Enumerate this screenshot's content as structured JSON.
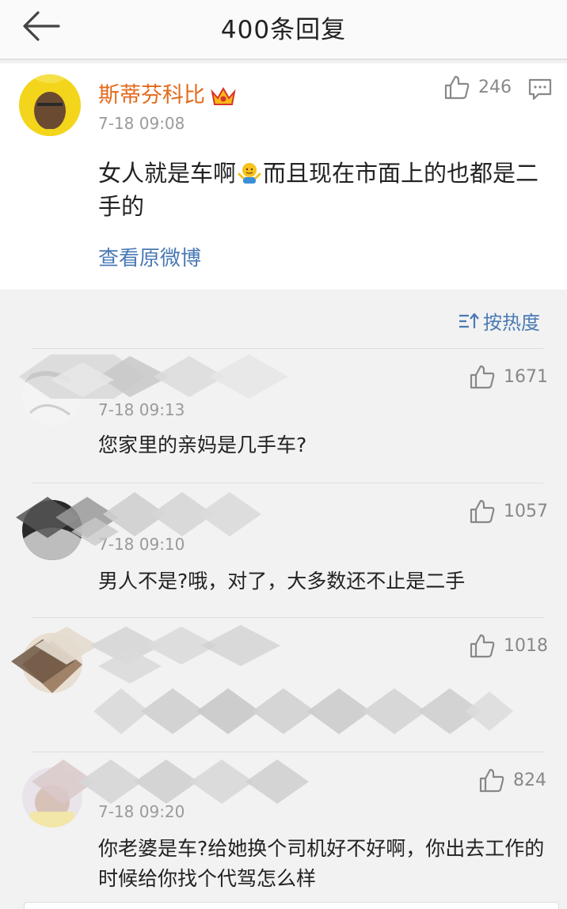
{
  "header": {
    "title": "400条回复"
  },
  "origin": {
    "name": "斯蒂芬科比",
    "time": "7-18 09:08",
    "likes": "246",
    "text_part1": "女人就是车啊",
    "text_part2": "而且现在市面上的也都是二手的",
    "view_original": "查看原微博"
  },
  "sort": {
    "label": "按热度"
  },
  "comments": [
    {
      "name": "",
      "time": "7-18 09:13",
      "likes": "1671",
      "text": "您家里的亲妈是几手车?"
    },
    {
      "name": "",
      "time": "7-18 09:10",
      "likes": "1057",
      "text": "男人不是?哦，对了，大多数还不止是二手"
    },
    {
      "name": "",
      "time": "",
      "likes": "1018",
      "text": ""
    },
    {
      "name": "",
      "time": "7-18 09:20",
      "likes": "824",
      "text": "你老婆是车?给她换个司机好不好啊，你出去工作的时候给你找个代驾怎么样"
    }
  ],
  "icons": {
    "back": "back-arrow-icon",
    "like": "thumb-up-icon",
    "reply": "comment-bubble-icon",
    "vip": "crown-icon",
    "sort": "sort-icon",
    "emoji": "shrug-emoji-icon"
  },
  "colors": {
    "username": "#e36a1b",
    "link": "#4a7ab5",
    "meta": "#9a9a9a"
  }
}
